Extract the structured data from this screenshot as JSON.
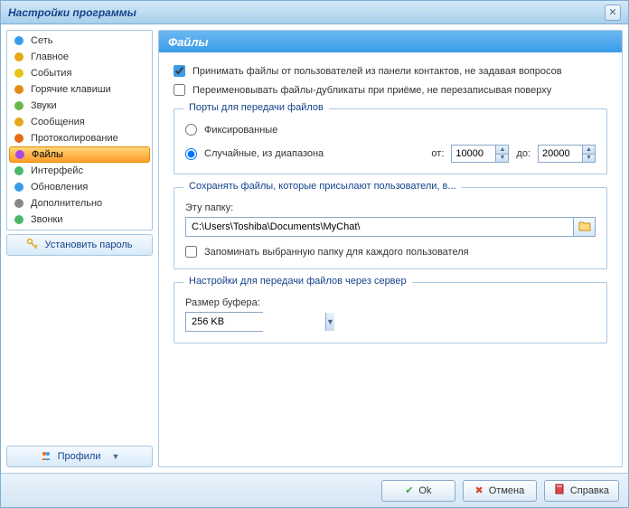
{
  "window": {
    "title": "Настройки программы"
  },
  "sidebar": {
    "items": [
      {
        "label": "Сеть",
        "icon": "#3a9be8"
      },
      {
        "label": "Главное",
        "icon": "#e6a817"
      },
      {
        "label": "События",
        "icon": "#e6c417"
      },
      {
        "label": "Горячие клавиши",
        "icon": "#e68a17"
      },
      {
        "label": "Звуки",
        "icon": "#6bb84a"
      },
      {
        "label": "Сообщения",
        "icon": "#e6a817"
      },
      {
        "label": "Протоколирование",
        "icon": "#e66a17"
      },
      {
        "label": "Файлы",
        "icon": "#a64ae6",
        "selected": true
      },
      {
        "label": "Интерфейс",
        "icon": "#4ab86b"
      },
      {
        "label": "Обновления",
        "icon": "#3a9be8"
      },
      {
        "label": "Дополнительно",
        "icon": "#888"
      },
      {
        "label": "Звонки",
        "icon": "#4ab86b"
      }
    ],
    "password_btn": "Установить пароль",
    "profiles_btn": "Профили"
  },
  "content": {
    "title": "Файлы",
    "accept_no_ask": "Принимать файлы от пользователей из панели контактов, не задавая вопросов",
    "rename_dupes": "Переименовывать файлы-дубликаты при приёме, не перезаписывая поверху",
    "ports_group": "Порты для передачи файлов",
    "radio_fixed": "Фиксированные",
    "radio_range": "Случайные, из диапазона",
    "from_label": "от:",
    "to_label": "до:",
    "port_from": "10000",
    "port_to": "20000",
    "save_group": "Сохранять файлы, которые присылают пользователи, в...",
    "folder_label": "Эту папку:",
    "folder_path": "C:\\Users\\Toshiba\\Documents\\MyChat\\",
    "remember_folder": "Запоминать выбранную папку для каждого пользователя",
    "server_group": "Настройки для передачи файлов через сервер",
    "buffer_label": "Размер буфера:",
    "buffer_value": "256 KB"
  },
  "footer": {
    "ok": "Ok",
    "cancel": "Отмена",
    "help": "Справка"
  }
}
